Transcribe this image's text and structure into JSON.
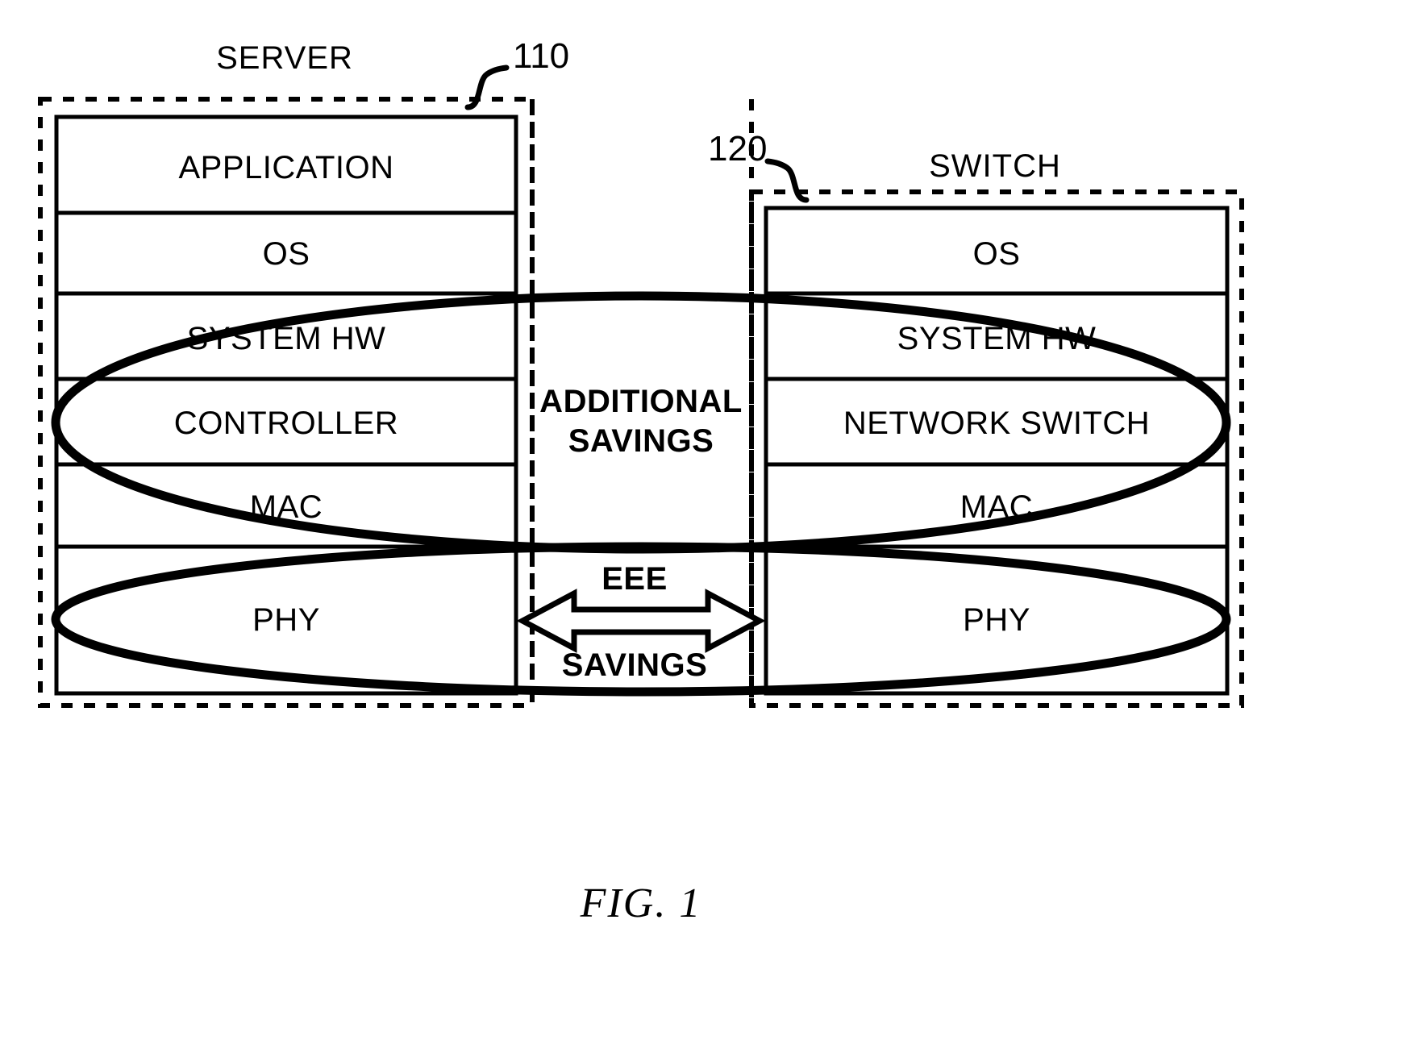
{
  "figure": {
    "caption": "FIG. 1",
    "background_color": "#ffffff",
    "stroke_color": "#000000"
  },
  "server": {
    "title": "SERVER",
    "ref_number": "110",
    "layers": [
      {
        "label": "APPLICATION"
      },
      {
        "label": "OS"
      },
      {
        "label": "SYSTEM HW"
      },
      {
        "label": "CONTROLLER"
      },
      {
        "label": "MAC"
      },
      {
        "label": "PHY"
      }
    ]
  },
  "switch": {
    "title": "SWITCH",
    "ref_number": "120",
    "layers": [
      {
        "label": "OS"
      },
      {
        "label": "SYSTEM HW"
      },
      {
        "label": "NETWORK SWITCH"
      },
      {
        "label": "MAC"
      },
      {
        "label": "PHY"
      }
    ]
  },
  "middle": {
    "additional_savings_line1": "ADDITIONAL",
    "additional_savings_line2": "SAVINGS",
    "eee_label": "EEE",
    "savings_label": "SAVINGS",
    "arrow_name": "double-headed-arrow"
  },
  "annotations": {
    "upper_ellipse_name": "additional-savings-ellipse",
    "lower_ellipse_name": "eee-savings-ellipse"
  }
}
